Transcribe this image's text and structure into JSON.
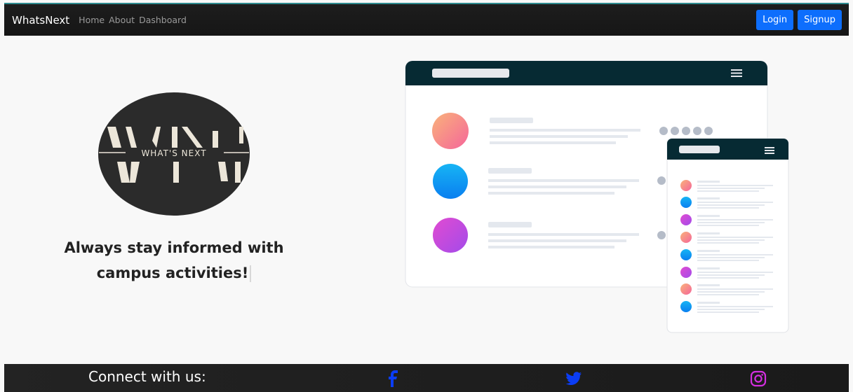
{
  "navbar": {
    "brand": "WhatsNext",
    "links": [
      "Home",
      "About",
      "Dashboard"
    ],
    "login_label": "Login",
    "signup_label": "Signup"
  },
  "hero": {
    "logo_text": "WHAT'S NEXT",
    "tagline_line1": "Always stay informed with",
    "tagline_line2": "campus activities!"
  },
  "footer": {
    "connect_text": "Connect with us:",
    "social_icons": [
      "facebook-icon",
      "twitter-icon",
      "instagram-icon"
    ]
  },
  "colors": {
    "accent": "#0d6efd",
    "navbar_bg": "#1b1b1b",
    "illustration_header": "#062a33",
    "social_blue": "#0b3df5",
    "instagram": "#d42fe0"
  }
}
